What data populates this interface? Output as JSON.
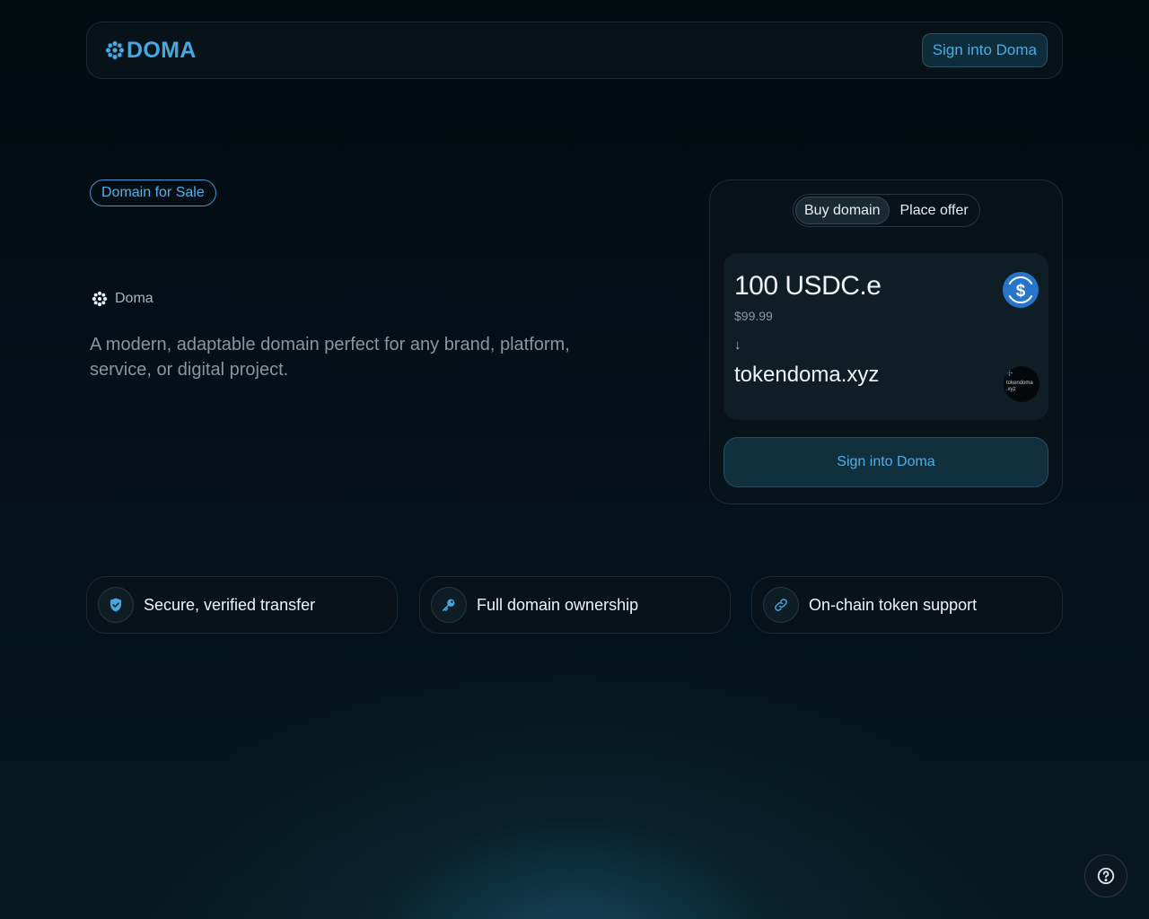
{
  "header": {
    "logo_text": "DOMA",
    "sign_in_label": "Sign into Doma",
    "logo_icon": "doma-flower-icon"
  },
  "hero": {
    "badge": "Domain for Sale",
    "brand_label": "Doma",
    "description": "A modern, adaptable domain perfect for any brand, platform, service, or digital project."
  },
  "purchase_card": {
    "tabs": [
      {
        "label": "Buy domain",
        "active": true
      },
      {
        "label": "Place offer",
        "active": false
      }
    ],
    "amount": "100 USDC.e",
    "usd_value": "$99.99",
    "arrow": "↓",
    "domain": "tokendoma.xyz",
    "domain_avatar_text": "tokendoma .xyz",
    "coin_icon": "usdc-coin-icon",
    "button_label": "Sign into Doma"
  },
  "features": [
    {
      "label": "Secure, verified transfer",
      "icon": "shield-check-icon"
    },
    {
      "label": "Full domain ownership",
      "icon": "key-icon"
    },
    {
      "label": "On-chain token support",
      "icon": "link-icon"
    }
  ],
  "help_icon": "help-circle-icon",
  "colors": {
    "accent": "#46a8e0",
    "background": "#020b10",
    "button_bg": "#11303e"
  }
}
